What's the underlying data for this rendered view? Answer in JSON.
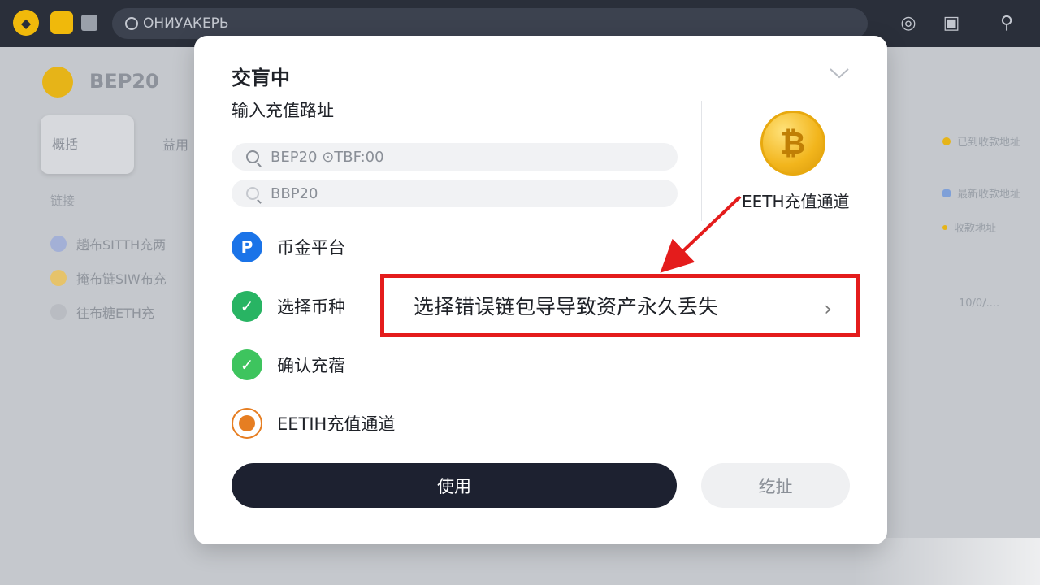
{
  "topbar": {
    "search_text": "ОНИУАКЕРЬ",
    "icons": [
      "logo-icon",
      "home-icon",
      "grid-icon",
      "globe-icon",
      "chat-icon",
      "search-icon"
    ]
  },
  "background": {
    "title": "BEP20",
    "tab_active": "概括",
    "tab_other": "益用",
    "label": "链接",
    "rows": [
      "趟布SITTH充两",
      "掩布链SIW布充",
      "往布糖ETH充"
    ],
    "right_items": [
      "已到收款地址",
      "最新收款地址",
      "收款地址",
      "10/0/...."
    ]
  },
  "modal": {
    "title": "交肓中",
    "subtitle": "输入充值路址",
    "input1": "BEP20 ⊙TBF:00",
    "input2": "BBP20",
    "options": [
      {
        "label": "币金平台",
        "icon": "p-badge-icon"
      },
      {
        "label": "选择币种",
        "icon": "check-circle-icon"
      },
      {
        "label": "确认充蓿",
        "icon": "check-circle-icon"
      },
      {
        "label": "EETIH充值通道",
        "icon": "eth-coin-icon"
      }
    ],
    "coin_label": "EETH充值通道",
    "warning": "选择错误链包导导致资产永久丢失",
    "primary_button": "使用",
    "secondary_button": "纥扯",
    "colors": {
      "warning_border": "#e41c1c",
      "primary_bg": "#1d2130",
      "coin": "#f2b51c"
    }
  }
}
